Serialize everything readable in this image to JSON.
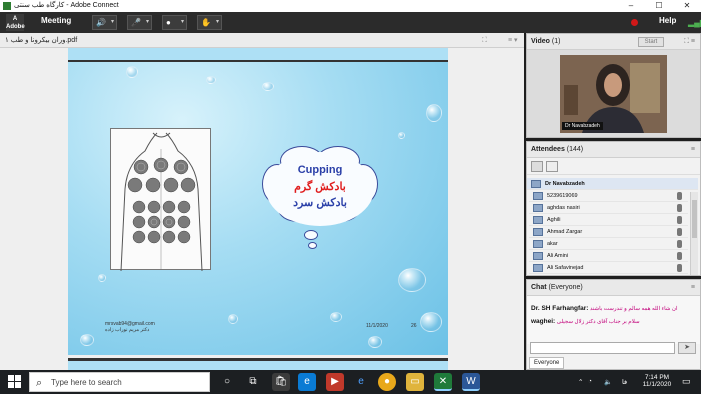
{
  "window": {
    "title": "کارگاه طب سنتی - Adobe Connect",
    "minimize": "–",
    "maximize": "☐",
    "close": "✕"
  },
  "menubar": {
    "adobe_label": "Adobe",
    "meeting": "Meeting",
    "help": "Help",
    "tool_icons": [
      "speaker-icon",
      "mic-icon",
      "webcam-icon",
      "raise-hand-icon"
    ]
  },
  "share_pod": {
    "title": "وران بیکرونا و طب ۱.pdf",
    "slide": {
      "cloud_title": "Cupping",
      "cloud_line2": "بادکش گرم",
      "cloud_line3": "بادکش سرد",
      "footer_email": "mrsvab94@gmail.com",
      "footer_name": "دکتر مریم نوراب زاده",
      "footer_date": "11/1/2020",
      "footer_page": "26"
    }
  },
  "video_pod": {
    "title": "Video",
    "count": "(1)",
    "start_label": "Start",
    "presenter_label": "Dr Navabzadeh"
  },
  "attendees_pod": {
    "title": "Attendees",
    "count": "(144)",
    "host": "Dr Navabzadeh",
    "rows": [
      "5239619069",
      "aghdas nasiri",
      "Aghili",
      "Ahmad Zargar",
      "akar",
      "Ali Amini",
      "Ali Safavinejad"
    ]
  },
  "chat_pod": {
    "title": "Chat",
    "subtitle": "(Everyone)",
    "messages": [
      {
        "who": "Dr. SH Farhangfar:",
        "text": "ان شاء الله همه سالم و تندرست باشند"
      },
      {
        "who": "waghei:",
        "text": "سلام بر جناب آقای دکتر زلال سجیلی"
      }
    ],
    "everyone_tab": "Everyone",
    "send_icon": "send-icon"
  },
  "taskbar": {
    "search_placeholder": "Type here to search",
    "time": "7:14 PM",
    "date": "11/1/2020",
    "lang": "فا"
  }
}
